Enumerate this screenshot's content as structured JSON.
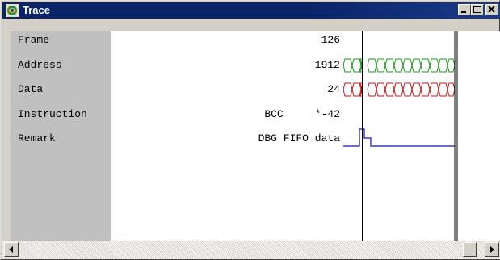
{
  "window": {
    "title": "Trace"
  },
  "title_buttons": {
    "minimize_icon": "minimize-icon",
    "maximize_icon": "maximize-icon",
    "close_icon": "close-icon"
  },
  "signals": [
    {
      "name": "Frame",
      "value": "126"
    },
    {
      "name": "Address",
      "value": "1912"
    },
    {
      "name": "Data",
      "value": "24"
    },
    {
      "name": "Instruction",
      "value": "BCC     *-42"
    },
    {
      "name": "Remark",
      "value": "DBG FIFO data"
    }
  ],
  "colors": {
    "address_wave": "#1a9a1a",
    "data_wave": "#c01818",
    "remark_wave": "#1010c0",
    "title_bar": "#0a246a"
  }
}
